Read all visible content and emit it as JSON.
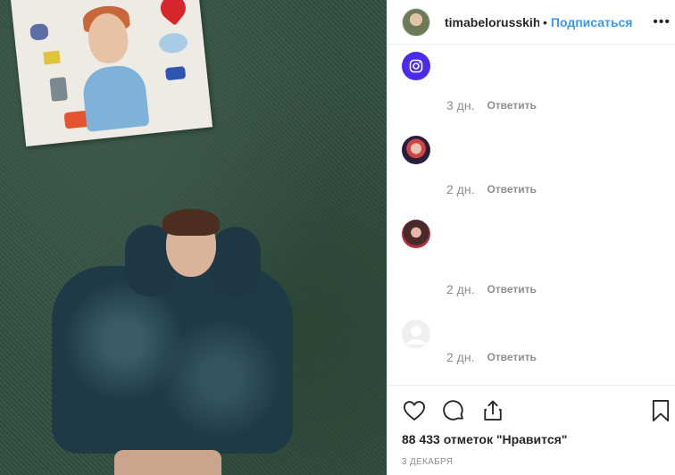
{
  "header": {
    "username": "timabelorusskih",
    "separator": "•",
    "follow_label": "Подписаться",
    "more_icon": "more-horizontal-icon"
  },
  "comments": [
    {
      "avatar": "instagram-icon",
      "time": "3 дн.",
      "reply_label": "Ответить"
    },
    {
      "avatar": "user-avatar",
      "time": "2 дн.",
      "reply_label": "Ответить"
    },
    {
      "avatar": "user-avatar",
      "time": "2 дн.",
      "reply_label": "Ответить"
    },
    {
      "avatar": "default-avatar-icon",
      "time": "2 дн.",
      "reply_label": "Ответить"
    }
  ],
  "actions": {
    "like_icon": "heart-icon",
    "comment_icon": "comment-icon",
    "share_icon": "share-icon",
    "save_icon": "bookmark-icon"
  },
  "likes_text": "88 433 отметок \"Нравится\"",
  "date_text": "3 ДЕКАБРЯ",
  "colors": {
    "link": "#3897f0",
    "text": "#262626",
    "muted": "#8e8e8e",
    "instagram_avatar": "#4b2bea"
  }
}
